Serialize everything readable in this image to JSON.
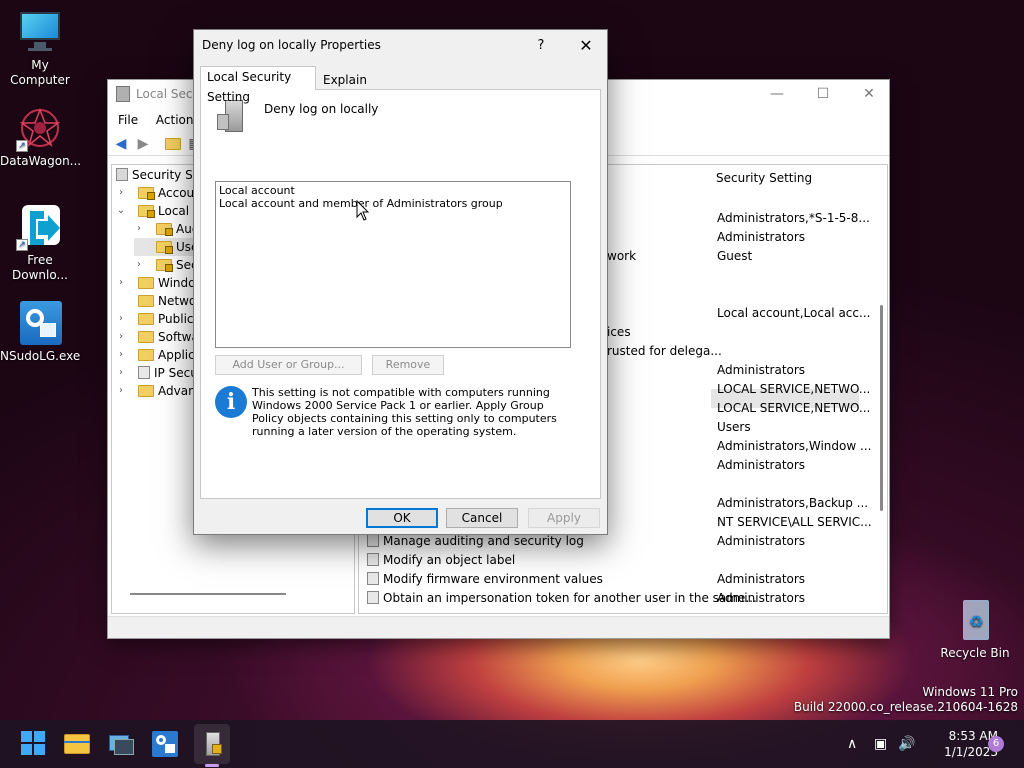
{
  "desktop": {
    "icons": [
      {
        "label": "My Computer"
      },
      {
        "label": "DataWagon..."
      },
      {
        "label": "Free Downlo..."
      },
      {
        "label": "NSudoLG.exe"
      },
      {
        "label": "Recycle Bin"
      }
    ],
    "watermark": {
      "line1": "Windows 11 Pro",
      "line2": "Build 22000.co_release.210604-1628"
    }
  },
  "lsp_window": {
    "title": "Local Secu",
    "menu": {
      "file": "File",
      "action": "Action"
    },
    "tree": {
      "items": [
        {
          "label": "Security Se",
          "expander": ""
        },
        {
          "label": "Accoun",
          "expander": "›"
        },
        {
          "label": "Local P",
          "expander": "⌄"
        },
        {
          "label": "Aud",
          "expander": "›"
        },
        {
          "label": "Use",
          "expander": ""
        },
        {
          "label": "Sec",
          "expander": "›"
        },
        {
          "label": "Windov",
          "expander": "›"
        },
        {
          "label": "Networ",
          "expander": ""
        },
        {
          "label": "Public I",
          "expander": "›"
        },
        {
          "label": "Softwa",
          "expander": "›"
        },
        {
          "label": "Applica",
          "expander": "›"
        },
        {
          "label": "IP Secu",
          "expander": "›"
        },
        {
          "label": "Advanc",
          "expander": "›"
        }
      ]
    },
    "list": {
      "column_header": "Security Setting",
      "policy_fragments": [
        {
          "text": "work"
        },
        {
          "text": "ices"
        },
        {
          "text": "rusted for delega..."
        }
      ],
      "settings": [
        "Administrators,*S-1-5-8...",
        "Administrators",
        "Guest",
        "Local account,Local acc...",
        "Administrators",
        "LOCAL SERVICE,NETWO...",
        "LOCAL SERVICE,NETWO...",
        "Users",
        "Administrators,Window ...",
        "Administrators",
        "Administrators,Backup ...",
        "NT SERVICE\\ALL SERVIC...",
        "Administrators",
        "",
        "Administrators",
        "Administrators"
      ],
      "policies_visible": [
        "Manage auditing and security log",
        "Modify an object label",
        "Modify firmware environment values",
        "Obtain an impersonation token for another user in the same..."
      ]
    }
  },
  "dialog": {
    "title": "Deny log on locally Properties",
    "help": "?",
    "close": "✕",
    "tabs": {
      "setting": "Local Security Setting",
      "explain": "Explain"
    },
    "policy_name": "Deny log on locally",
    "accounts": [
      "Local account",
      "Local account and member of Administrators group"
    ],
    "add_button": "Add User or Group...",
    "remove_button": "Remove",
    "info_icon": "i",
    "info_text": "This setting is not compatible with computers running Windows 2000 Service Pack 1 or earlier.  Apply Group Policy objects containing this setting only to computers running a later version of the operating system.",
    "ok": "OK",
    "cancel": "Cancel",
    "apply": "Apply"
  },
  "taskbar": {
    "time": "8:53 AM",
    "date": "1/1/2023",
    "notification_count": "6",
    "chevron": "∧"
  }
}
